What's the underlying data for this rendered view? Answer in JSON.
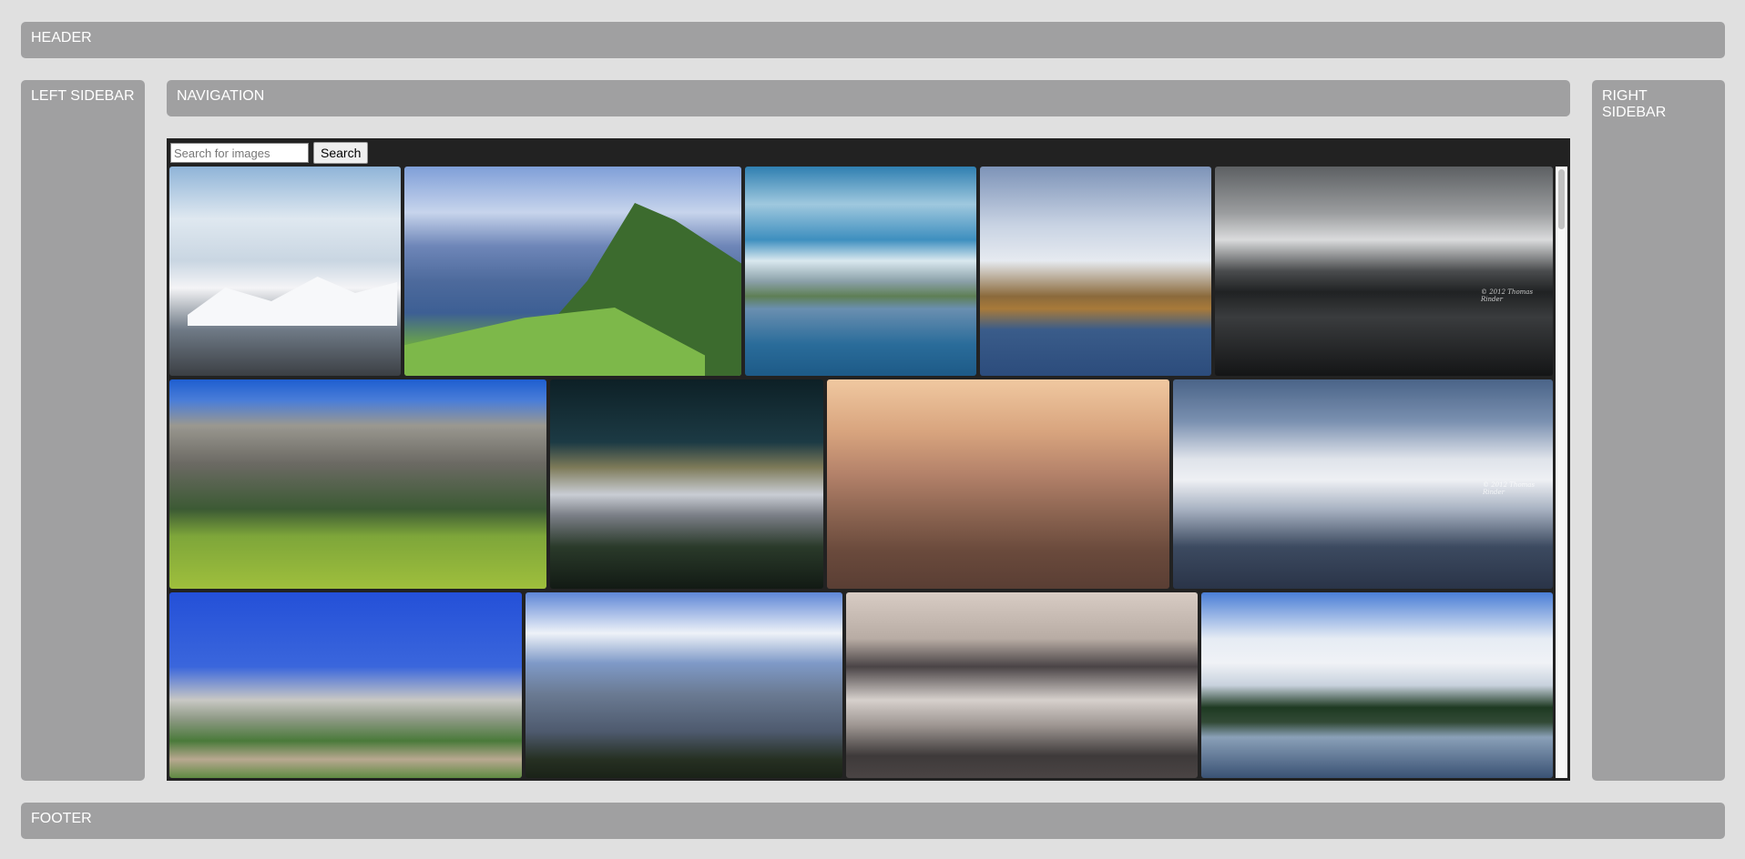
{
  "layout_labels": {
    "header": "HEADER",
    "left_sidebar": "LEFT SIDEBAR",
    "navigation": "NAVIGATION",
    "right_sidebar": "RIGHT SIDEBAR",
    "footer": "FOOTER"
  },
  "search": {
    "placeholder": "Search for images",
    "button_label": "Search"
  },
  "images": [
    {
      "subject": "snowy peaks under clouds",
      "scene": "snow"
    },
    {
      "subject": "green ridge above lake",
      "scene": "green"
    },
    {
      "subject": "lake with snowy range and dramatic sky",
      "scene": "lake-blue"
    },
    {
      "subject": "autumn valley lake with snowy peaks",
      "scene": "lake-autumn"
    },
    {
      "subject": "dark mountain reflection",
      "scene": "dark",
      "watermark": "© 2012 Thomas Rinder"
    },
    {
      "subject": "alpine meadow with rocky peaks",
      "scene": "meadow"
    },
    {
      "subject": "night sky over snowy mountains",
      "scene": "night"
    },
    {
      "subject": "misty ridges at sunset",
      "scene": "haze"
    },
    {
      "subject": "snow-covered mountain ridge",
      "scene": "snow-ridge",
      "watermark": "© 2012 Thomas Rinder"
    },
    {
      "subject": "alpine village below limestone massif",
      "scene": "village"
    },
    {
      "subject": "jagged peaks under cloudy sky",
      "scene": "jagged"
    },
    {
      "subject": "peaks rising above clouds",
      "scene": "clouds"
    },
    {
      "subject": "lake reflecting snowy range",
      "scene": "lake-snow"
    }
  ],
  "colors": {
    "page_bg": "#e0e0e0",
    "panel_bg": "#a0a0a1",
    "gallery_bg": "#222222"
  }
}
